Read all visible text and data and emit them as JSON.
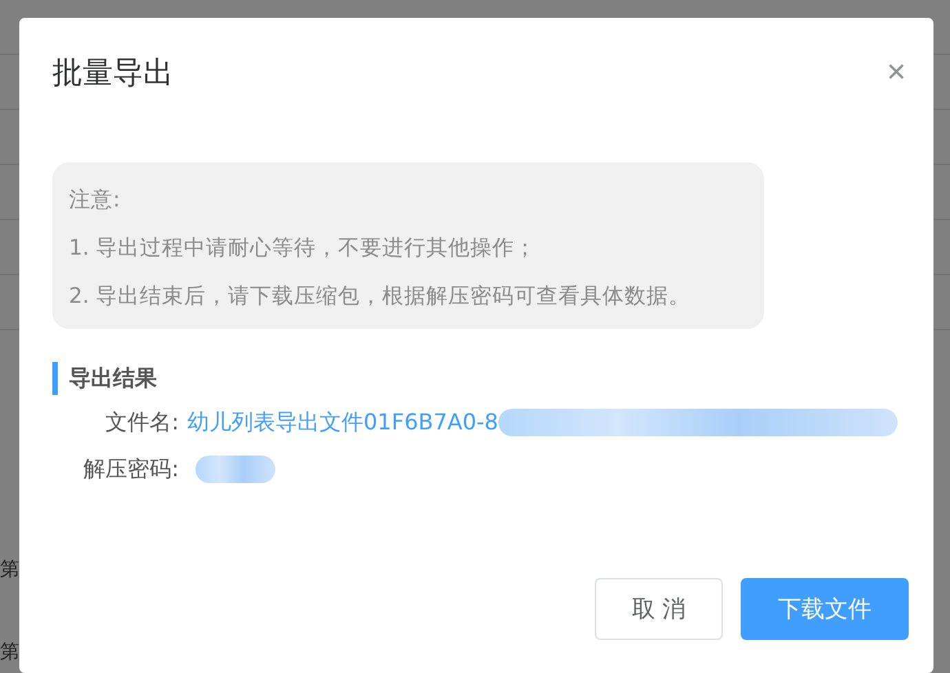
{
  "background": {
    "row_labels": [
      "第",
      "第"
    ]
  },
  "dialog": {
    "title": "批量导出",
    "close": "×",
    "notice": {
      "heading": "注意:",
      "lines": [
        "1. 导出过程中请耐心等待，不要进行其他操作；",
        "2. 导出结束后，请下载压缩包，根据解压密码可查看具体数据。"
      ]
    },
    "result": {
      "heading": "导出结果",
      "fields": [
        {
          "label": "文件名:",
          "value": "幼儿列表导出文件01F6B7A0-8",
          "kind": "link",
          "redacted": true
        },
        {
          "label": "解压密码:",
          "kind": "secret",
          "redacted": true
        }
      ]
    },
    "buttons": [
      {
        "label": "取 消",
        "kind": "default"
      },
      {
        "label": "下载文件",
        "kind": "primary"
      }
    ]
  }
}
